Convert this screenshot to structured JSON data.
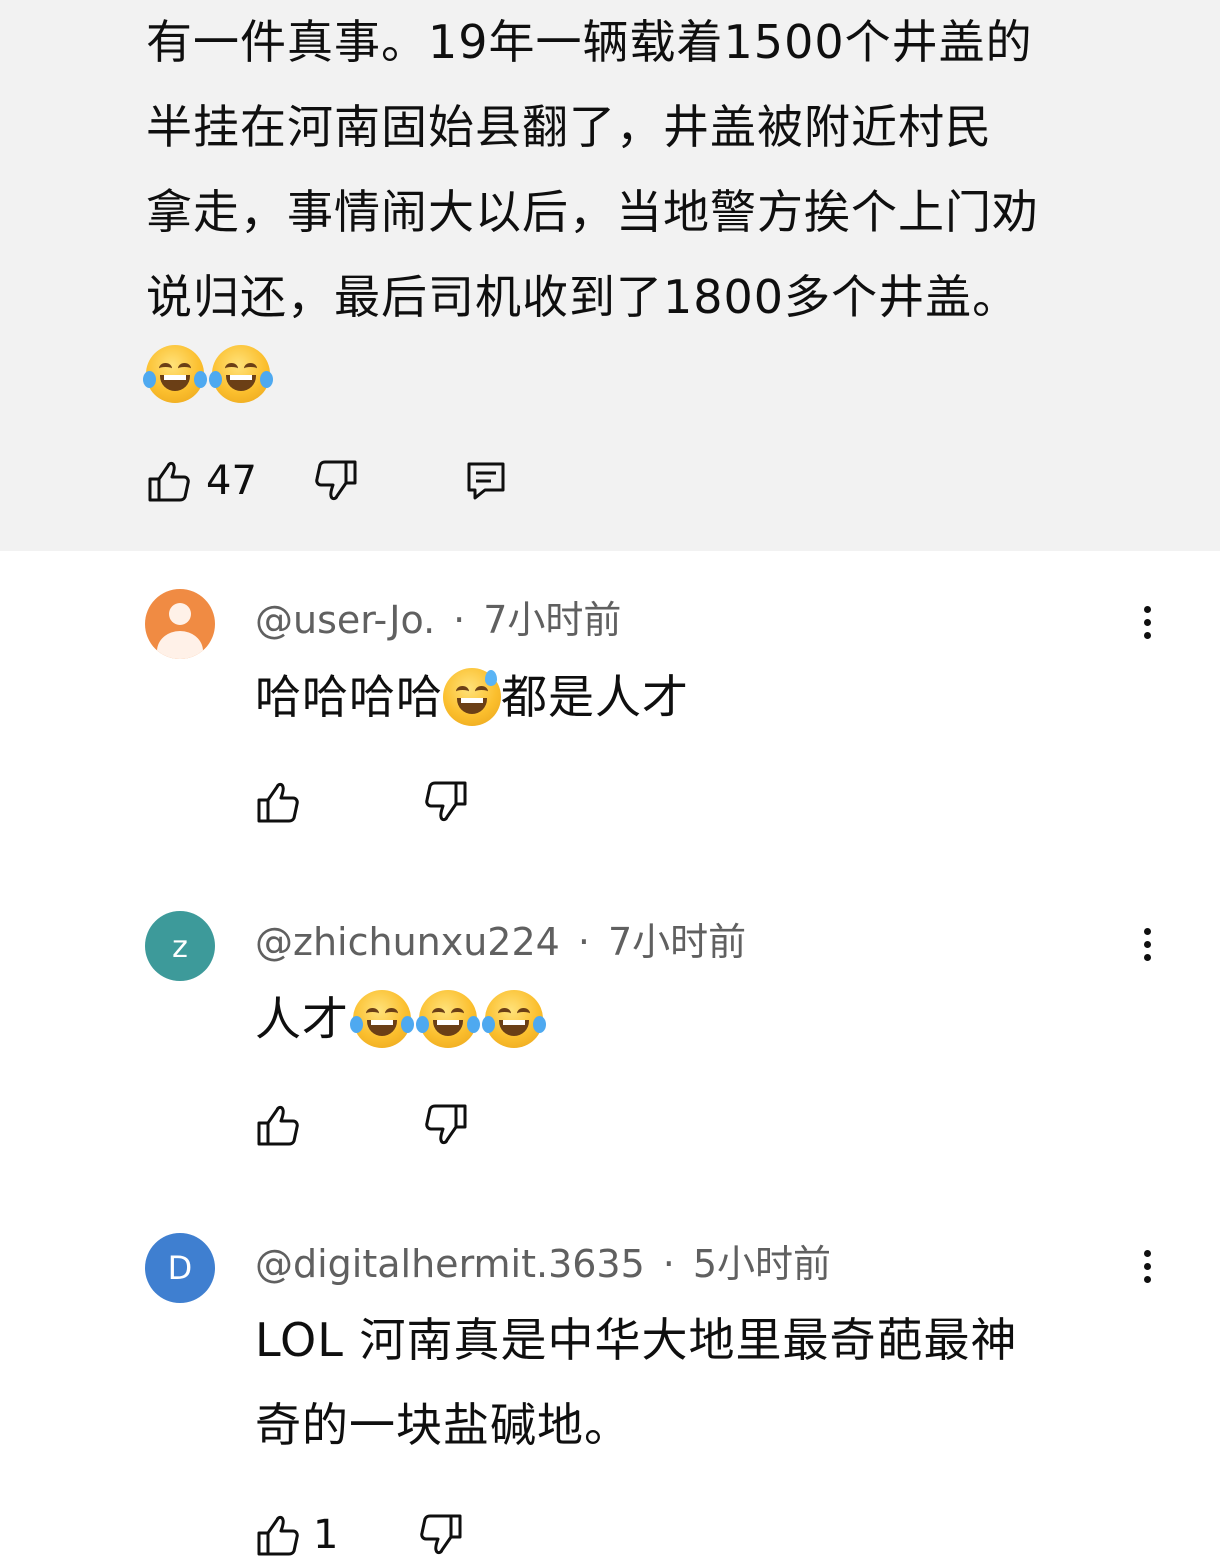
{
  "top_comment": {
    "lines": [
      "有一件真事。19年一辆载着1500个井盖的",
      "半挂在河南固始县翻了，井盖被附近村民",
      "拿走，事情闹大以后，当地警方挨个上门劝",
      "说归还，最后司机收到了1800多个井盖。"
    ],
    "emojis": [
      "face-with-tears-of-joy",
      "face-with-tears-of-joy"
    ],
    "like_count": "47"
  },
  "comments": [
    {
      "author": "@user-Jo.",
      "separator": "·",
      "time": "7小时前",
      "avatar_type": "photo",
      "avatar_color": "#f08b43",
      "text_before": "哈哈哈哈",
      "emoji": "grinning-face-with-sweat",
      "text_after": "都是人才",
      "like_count": ""
    },
    {
      "author": "@zhichunxu224",
      "separator": "·",
      "time": "7小时前",
      "avatar_letter": "Z",
      "avatar_color": "#3d9a9a",
      "text": "人才",
      "emojis": [
        "face-with-tears-of-joy",
        "face-with-tears-of-joy",
        "face-with-tears-of-joy"
      ],
      "like_count": ""
    },
    {
      "author": "@digitalhermit.3635",
      "separator": "·",
      "time": "5小时前",
      "avatar_letter": "D",
      "avatar_color": "#3f7fd0",
      "lines": [
        "LOL 河南真是中华大地里最奇葩最神",
        "奇的一块盐碱地。"
      ],
      "like_count": "1"
    }
  ],
  "icons": {
    "like": "thumbs-up-icon",
    "dislike": "thumbs-down-icon",
    "reply": "reply-icon",
    "more": "more-vertical-icon"
  }
}
